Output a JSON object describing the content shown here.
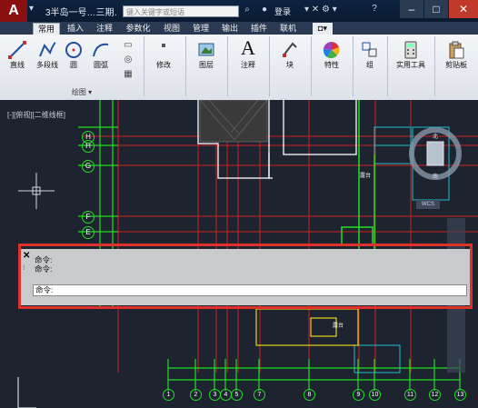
{
  "title_bar": {
    "app_logo": "A",
    "window_title": "3半岛一号…三期…",
    "search_placeholder": "键入关键字或短语",
    "login_label": "登录",
    "minimize_glyph": "–",
    "maximize_glyph": "□",
    "close_glyph": "✕"
  },
  "tabs": [
    "常用",
    "插入",
    "注释",
    "参数化",
    "视图",
    "管理",
    "输出",
    "插件",
    "联机"
  ],
  "ribbon": {
    "buttons": {
      "line": "直线",
      "polyline": "多段线",
      "circle": "圆",
      "arc": "圆弧",
      "modify": "修改",
      "layers": "图层",
      "annotation": "注释",
      "block": "块",
      "properties": "特性",
      "group": "组",
      "utilities": "实用工具",
      "clipboard": "剪贴板"
    },
    "panel_label": "绘图"
  },
  "viewport": {
    "label": "[-][俯视][二维线框]",
    "grid_bubbles_left": [
      "H",
      "H",
      "G",
      "F",
      "E"
    ],
    "grid_bubbles_bottom": [
      "1",
      "2",
      "3",
      "4",
      "5",
      "7",
      "8",
      "9",
      "10",
      "11",
      "12",
      "13"
    ],
    "room_labels": [
      "露台",
      "露台"
    ],
    "wcs_label": "WCS"
  },
  "command_window": {
    "history": [
      "命令:",
      "命令:"
    ],
    "prompt": "命令:"
  },
  "colors": {
    "accent_red": "#e0302a",
    "grid_red": "#d02020",
    "wall_green": "#22dd22",
    "cyan": "#20c0d0",
    "yellow": "#e8d020"
  }
}
